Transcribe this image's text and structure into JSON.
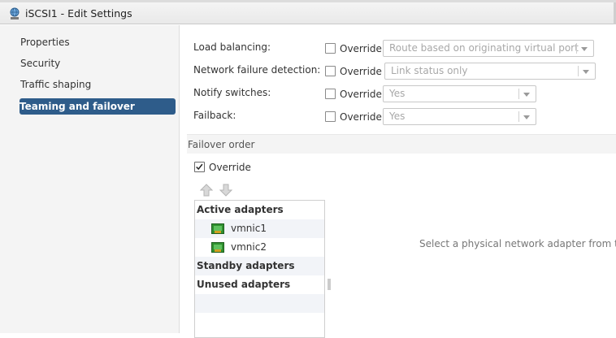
{
  "window": {
    "title": "iSCSI1 - Edit Settings",
    "icon": "network-portgroup-icon"
  },
  "sidebar": {
    "items": [
      {
        "label": "Properties",
        "selected": false
      },
      {
        "label": "Security",
        "selected": false
      },
      {
        "label": "Traffic shaping",
        "selected": false
      },
      {
        "label": "Teaming and failover",
        "selected": true
      }
    ]
  },
  "policies": {
    "override_label": "Override",
    "rows": [
      {
        "label": "Load balancing:",
        "override": false,
        "value": "Route based on originating virtual port"
      },
      {
        "label": "Network failure detection:",
        "override": false,
        "value": "Link status only"
      },
      {
        "label": "Notify switches:",
        "override": false,
        "value": "Yes"
      },
      {
        "label": "Failback:",
        "override": false,
        "value": "Yes"
      }
    ]
  },
  "failover": {
    "section_title": "Failover order",
    "override_label": "Override",
    "override_checked": true,
    "move_up_icon": "arrow-up-icon",
    "move_down_icon": "arrow-down-icon",
    "groups": [
      {
        "label": "Active adapters",
        "adapters": [
          "vmnic1",
          "vmnic2"
        ]
      },
      {
        "label": "Standby adapters",
        "adapters": []
      },
      {
        "label": "Unused adapters",
        "adapters": []
      }
    ],
    "hint": "Select a physical network adapter from the lis"
  },
  "colors": {
    "selected_bg": "#2e5c8a",
    "sidebar_bg": "#f4f4f4",
    "disabled_text": "#a8a8a8",
    "nic_green": "#3a9a3a"
  }
}
